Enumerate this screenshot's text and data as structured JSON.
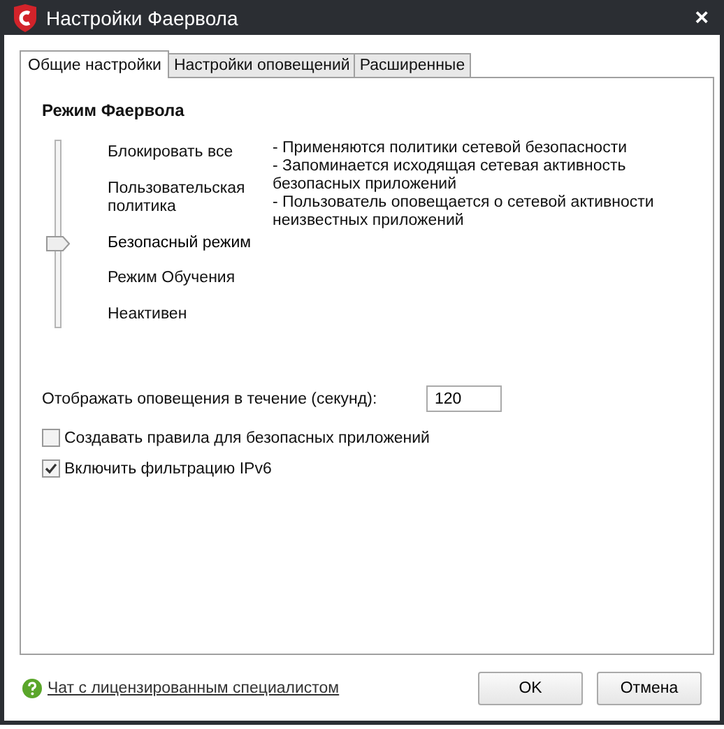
{
  "window": {
    "title": "Настройки Фаервола",
    "close": "×"
  },
  "tabs": [
    {
      "label": "Общие настройки",
      "selected": true
    },
    {
      "label": "Настройки оповещений",
      "selected": false
    },
    {
      "label": "Расширенные",
      "selected": false
    }
  ],
  "section_title": "Режим Фаервола",
  "modes": [
    {
      "label": "Блокировать все",
      "selected": false
    },
    {
      "label": "Пользовательская политика",
      "selected": false
    },
    {
      "label": "Безопасный режим",
      "selected": true
    },
    {
      "label": "Режим Обучения",
      "selected": false
    },
    {
      "label": "Неактивен",
      "selected": false
    }
  ],
  "description": [
    "- Применяются политики сетевой безопасности",
    "- Запоминается исходящая сетевая активность безопасных приложений",
    "- Пользователь оповещается о сетевой активности неизвестных приложений"
  ],
  "alert_duration": {
    "label": "Отображать оповещения в течение (секунд):",
    "value": "120"
  },
  "options": [
    {
      "label": "Создавать правила для безопасных приложений",
      "checked": false
    },
    {
      "label": "Включить фильтрацию IPv6",
      "checked": true
    }
  ],
  "help_link": "Чат с лицензированным специалистом",
  "buttons": [
    "OK",
    "Отмена"
  ]
}
